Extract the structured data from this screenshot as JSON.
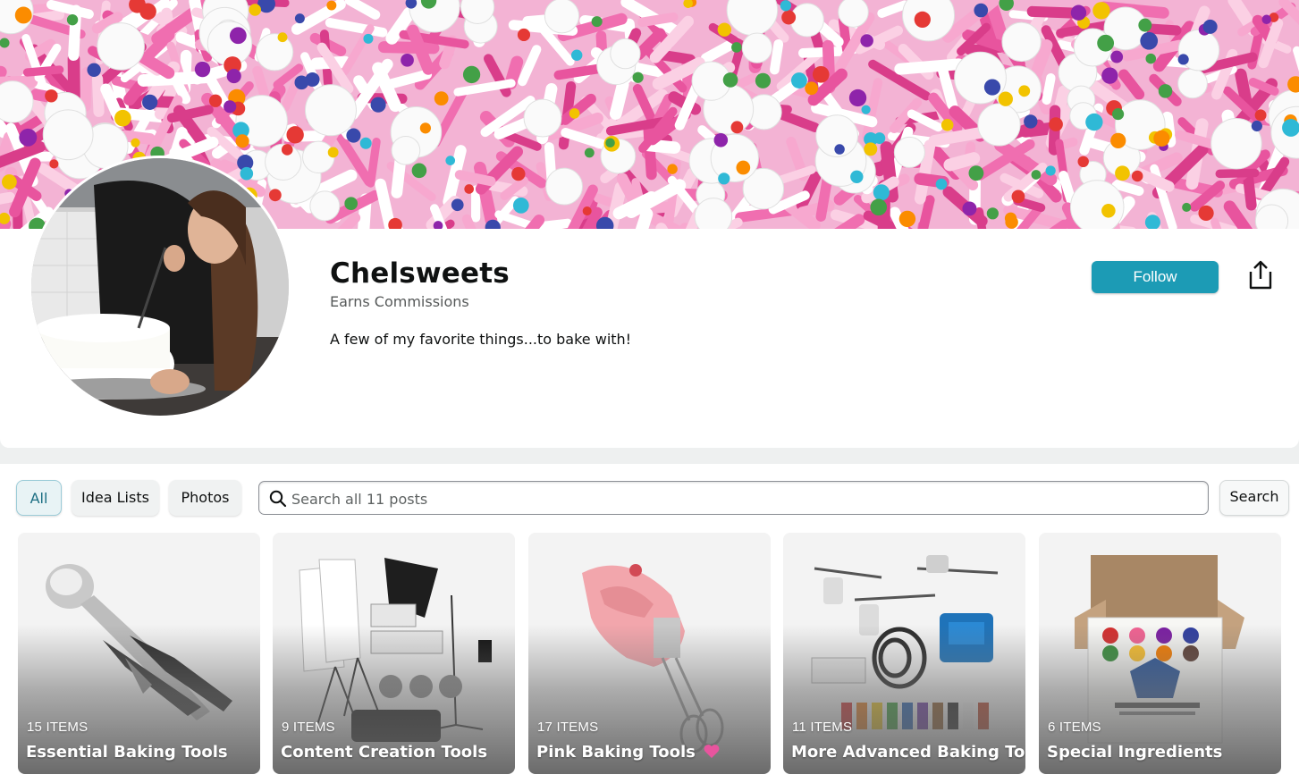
{
  "profile": {
    "name": "Chelsweets",
    "subtitle": "Earns Commissions",
    "bio": "A few of my favorite things...to bake with!",
    "follow_label": "Follow"
  },
  "filters": {
    "chips": [
      {
        "label": "All",
        "active": true
      },
      {
        "label": "Idea Lists",
        "active": false
      },
      {
        "label": "Photos",
        "active": false
      }
    ]
  },
  "search": {
    "placeholder": "Search all 11 posts",
    "button_label": "Search"
  },
  "posts": [
    {
      "count": "15 ITEMS",
      "title": "Essential Baking Tools"
    },
    {
      "count": "9 ITEMS",
      "title": "Content Creation Tools"
    },
    {
      "count": "17 ITEMS",
      "title": "Pink Baking Tools"
    },
    {
      "count": "11 ITEMS",
      "title": "More Advanced Baking Tools"
    },
    {
      "count": "6 ITEMS",
      "title": "Special Ingredients"
    }
  ],
  "colors": {
    "accent": "#1c9bb5",
    "banner_pink": "#e8549e"
  },
  "icons": {
    "share": "share-icon",
    "search": "search-icon",
    "heart": "heart-icon"
  }
}
